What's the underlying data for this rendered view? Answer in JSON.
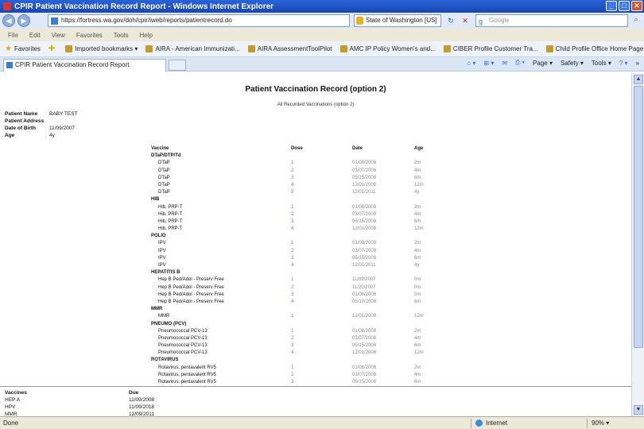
{
  "window": {
    "title": "CPIR Patient Vaccination Record Report - Windows Internet Explorer",
    "min": "_",
    "max": "□",
    "close": "✕"
  },
  "address": {
    "url": "https://fortress.wa.gov/doh/cpir/iweb/reports/patientrecord.do",
    "security": "State of Washington [US]",
    "search_placeholder": "Google"
  },
  "menu": [
    "File",
    "Edit",
    "View",
    "Favorites",
    "Tools",
    "Help"
  ],
  "favorites": {
    "label": "Favorites",
    "items": [
      "Imported bookmarks",
      "AIRA - American Immunizati...",
      "AIRA AssessmentToolPilot",
      "AMC IP Policy Women's and...",
      "CIBER Profile Customer Tra...",
      "Child Profile Office Home Page"
    ]
  },
  "tab": {
    "label": "CPIR Patient Vaccination Record Report"
  },
  "tools": {
    "page": "Page",
    "safety": "Safety",
    "tools": "Tools",
    "help": "?"
  },
  "report": {
    "title": "Patient Vaccination Record (option 2)",
    "subtitle": "All Recorded Vaccinations (option 2)",
    "patient": [
      {
        "label": "Patient Name",
        "value": "BABY TEST"
      },
      {
        "label": "Patient Address",
        "value": ""
      },
      {
        "label": "Date of Birth",
        "value": "11/09/2007"
      },
      {
        "label": "Age",
        "value": "4y"
      }
    ],
    "table_headers": {
      "vaccine": "Vaccine",
      "dose": "Dose",
      "date": "Date",
      "age": "Age"
    },
    "groups": [
      {
        "name": "DTaP/DTP/Td",
        "rows": [
          {
            "vaccine": "DTaP",
            "dose": "1",
            "date": "01/08/2008",
            "age": "2m"
          },
          {
            "vaccine": "DTaP",
            "dose": "2",
            "date": "03/07/2008",
            "age": "4m"
          },
          {
            "vaccine": "DTaP",
            "dose": "3",
            "date": "05/15/2008",
            "age": "6m"
          },
          {
            "vaccine": "DTaP",
            "dose": "4",
            "date": "12/01/2008",
            "age": "12m"
          },
          {
            "vaccine": "DTaP",
            "dose": "5",
            "date": "12/01/2011",
            "age": "4y"
          }
        ]
      },
      {
        "name": "HIB",
        "rows": [
          {
            "vaccine": "Hib, PRP-T",
            "dose": "1",
            "date": "01/08/2008",
            "age": "2m"
          },
          {
            "vaccine": "Hib, PRP-T",
            "dose": "2",
            "date": "03/07/2008",
            "age": "4m"
          },
          {
            "vaccine": "Hib, PRP-T",
            "dose": "3",
            "date": "05/15/2008",
            "age": "6m"
          },
          {
            "vaccine": "Hib, PRP-T",
            "dose": "4",
            "date": "12/01/2008",
            "age": "12m"
          }
        ]
      },
      {
        "name": "POLIO",
        "rows": [
          {
            "vaccine": "IPV",
            "dose": "1",
            "date": "01/08/2008",
            "age": "2m"
          },
          {
            "vaccine": "IPV",
            "dose": "2",
            "date": "03/07/2008",
            "age": "4m"
          },
          {
            "vaccine": "IPV",
            "dose": "3",
            "date": "05/15/2008",
            "age": "6m"
          },
          {
            "vaccine": "IPV",
            "dose": "4",
            "date": "12/01/2011",
            "age": "4y"
          }
        ]
      },
      {
        "name": "HEPATITIS B",
        "rows": [
          {
            "vaccine": "Hep B Ped/Adol - Preserv Free",
            "dose": "1",
            "date": "11/09/2007",
            "age": "0m"
          },
          {
            "vaccine": "Hep B Ped/Adol - Preserv Free",
            "dose": "2",
            "date": "11/20/2007",
            "age": "0m"
          },
          {
            "vaccine": "Hep B Ped/Adol - Preserv Free",
            "dose": "3",
            "date": "01/08/2008",
            "age": "0m"
          },
          {
            "vaccine": "Hep B Ped/Adol - Preserv Free",
            "dose": "4",
            "date": "05/10/2008",
            "age": "6m"
          }
        ]
      },
      {
        "name": "MMR",
        "rows": [
          {
            "vaccine": "MMR",
            "dose": "1",
            "date": "12/01/2008",
            "age": "12m"
          }
        ]
      },
      {
        "name": "PNEUMO (PCV)",
        "rows": [
          {
            "vaccine": "Pneumococcal PCV-13",
            "dose": "1",
            "date": "01/08/2008",
            "age": "2m"
          },
          {
            "vaccine": "Pneumococcal PCV-13",
            "dose": "2",
            "date": "03/07/2008",
            "age": "4m"
          },
          {
            "vaccine": "Pneumococcal PCV-13",
            "dose": "3",
            "date": "05/15/2008",
            "age": "6m"
          },
          {
            "vaccine": "Pneumococcal PCV-13",
            "dose": "4",
            "date": "12/01/2008",
            "age": "12m"
          }
        ]
      },
      {
        "name": "ROTAVIRUS",
        "rows": [
          {
            "vaccine": "Rotavirus, pentavalent RV5",
            "dose": "1",
            "date": "01/08/2008",
            "age": "2m"
          },
          {
            "vaccine": "Rotavirus, pentavalent RV5",
            "dose": "2",
            "date": "03/07/2008",
            "age": "4m"
          },
          {
            "vaccine": "Rotavirus, pentavalent RV5",
            "dose": "3",
            "date": "05/15/2008",
            "age": "6m"
          }
        ]
      }
    ],
    "due": {
      "headers": {
        "vaccines": "Vaccines",
        "due": "Due"
      },
      "rows": [
        {
          "vaccine": "HEP A",
          "due": "11/09/2008"
        },
        {
          "vaccine": "HPV",
          "due": "11/09/2018"
        },
        {
          "vaccine": "MMR",
          "due": "12/09/2011"
        }
      ]
    }
  },
  "status": {
    "left": "Done",
    "zone": "Internet",
    "zoom": "90%"
  }
}
